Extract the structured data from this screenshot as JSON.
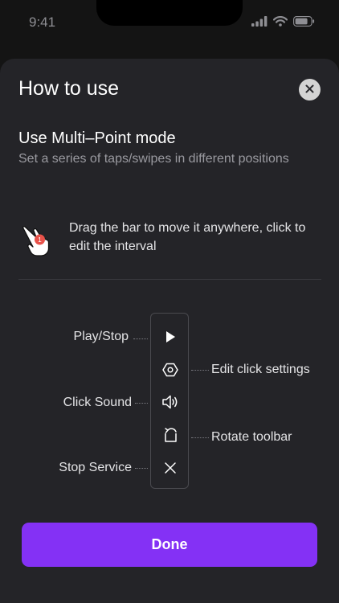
{
  "status_bar": {
    "time": "9:41"
  },
  "sheet": {
    "title": "How to use",
    "close_icon": "close-icon"
  },
  "mode": {
    "title": "Use Multi–Point mode",
    "description": "Set a series of taps/swipes in different positions"
  },
  "drag_tip": {
    "icon": "hand-tap-icon",
    "badge": "1",
    "text": "Drag the bar to move it anywhere, click to edit the interval"
  },
  "toolbar": {
    "items": [
      {
        "icon": "play-icon",
        "label": "Play/Stop",
        "side": "left"
      },
      {
        "icon": "hexagon-settings-icon",
        "label": "Edit click settings",
        "side": "right"
      },
      {
        "icon": "speaker-icon",
        "label": "Click Sound",
        "side": "left"
      },
      {
        "icon": "rotate-icon",
        "label": "Rotate toolbar",
        "side": "right"
      },
      {
        "icon": "close-icon",
        "label": "Stop Service",
        "side": "left"
      }
    ]
  },
  "done_button": {
    "label": "Done"
  },
  "colors": {
    "accent": "#8431f5",
    "sheet_bg": "#242428",
    "page_bg": "#141414"
  }
}
